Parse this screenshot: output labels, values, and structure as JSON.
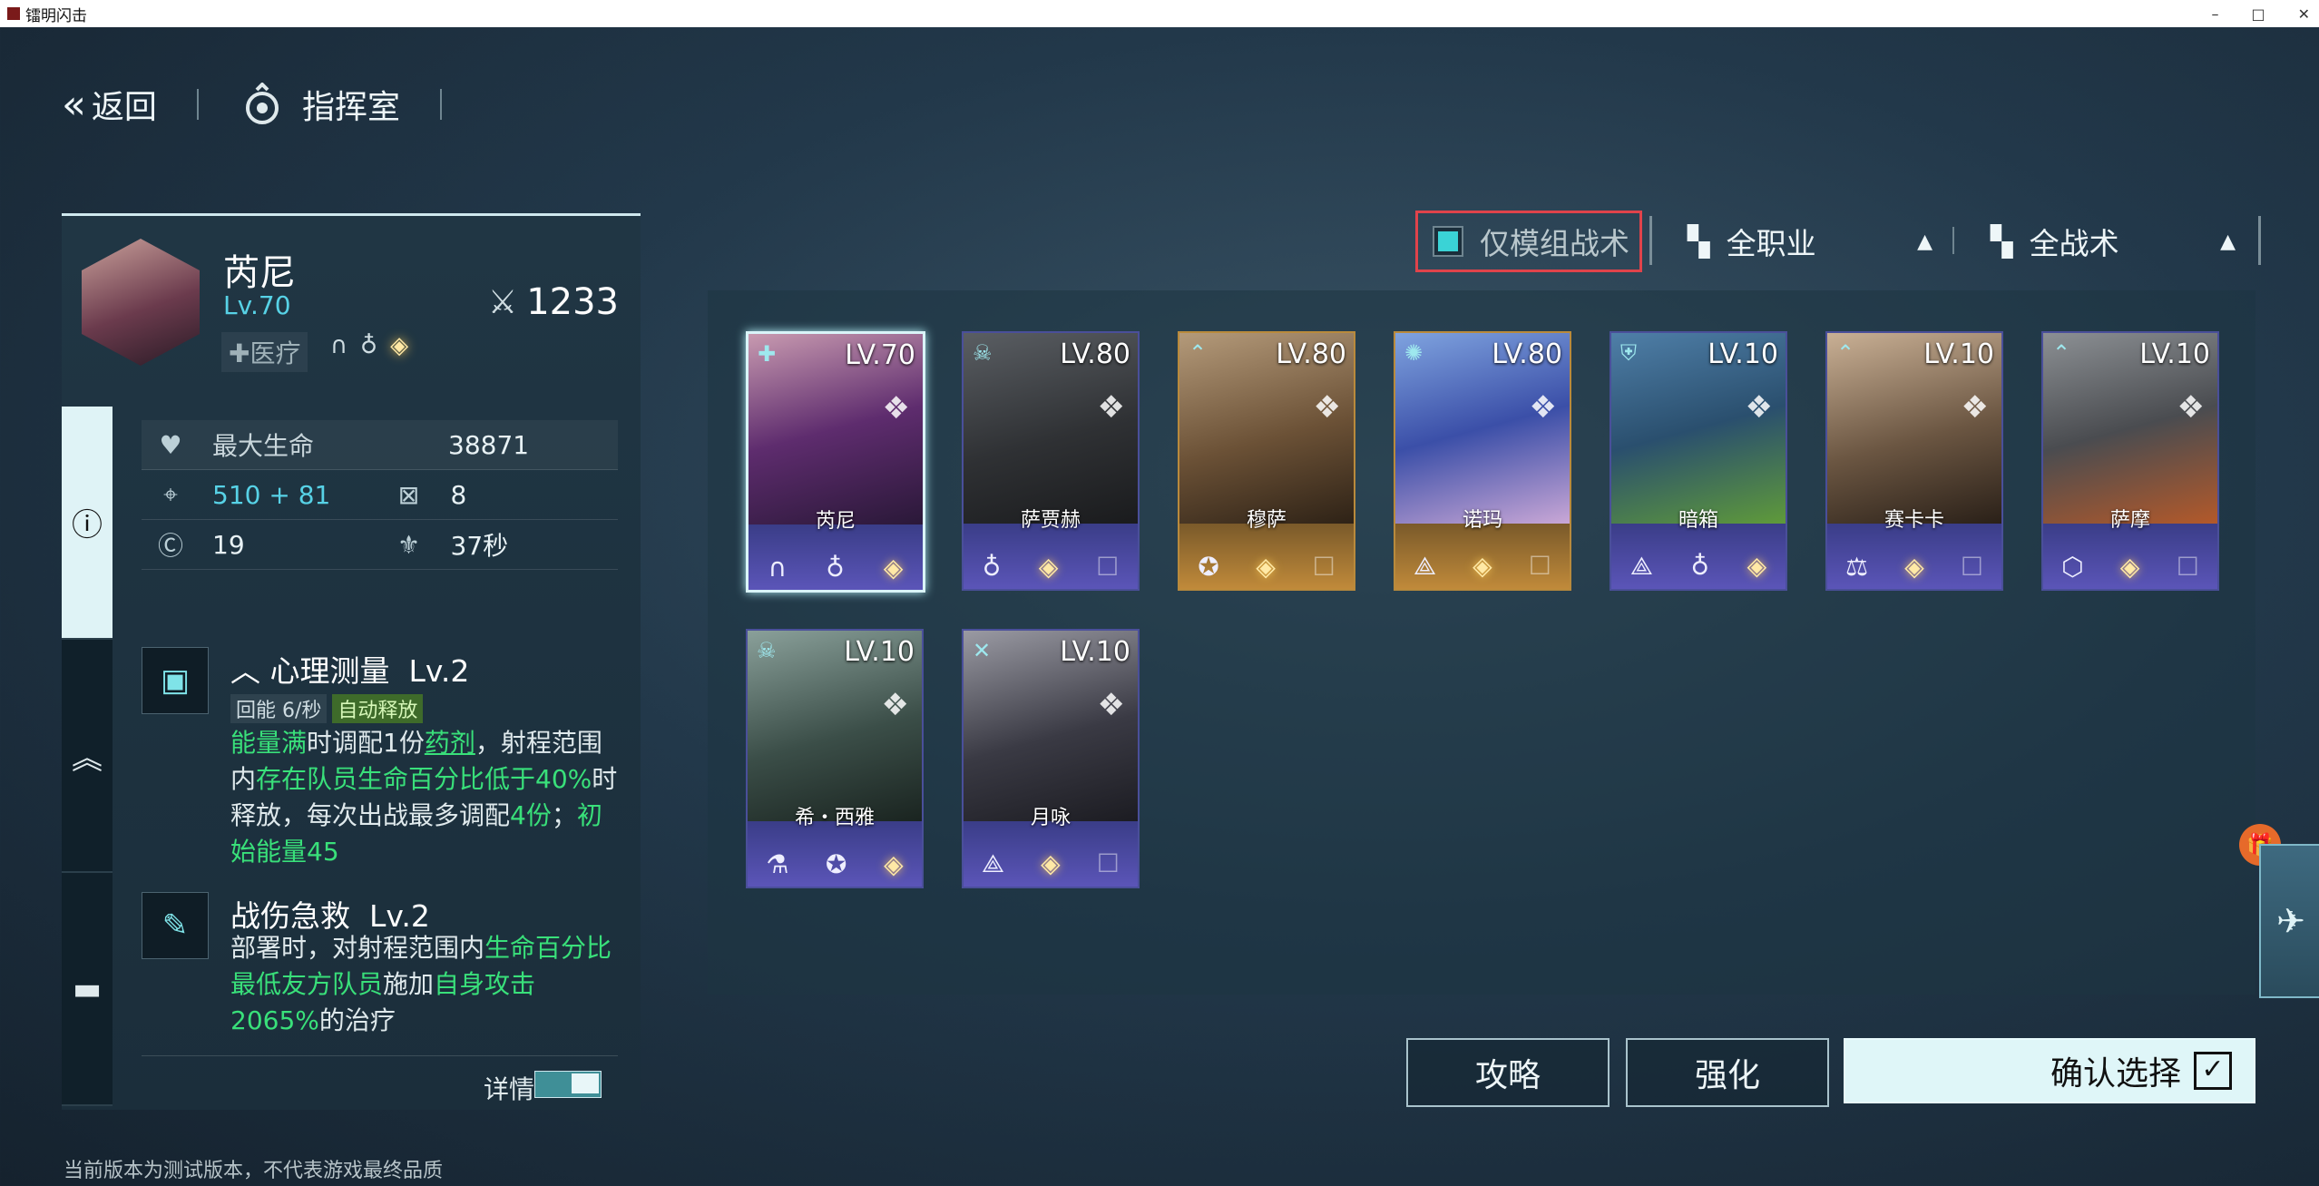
{
  "window": {
    "title": "镭明闪击",
    "controls": [
      "–",
      "□",
      "✕"
    ]
  },
  "nav": {
    "back_label": "返回",
    "room_label": "指挥室"
  },
  "character": {
    "name": "芮尼",
    "level": "Lv.70",
    "power": "1233",
    "role": "医疗",
    "stats": {
      "hp_label": "最大生命",
      "hp_value": "38871",
      "atk_base": "510",
      "atk_bonus": "+ 81",
      "range_value": "8",
      "cost_value": "19",
      "redeploy_value": "37秒"
    }
  },
  "skills": [
    {
      "name": "心理测量",
      "level": "Lv.2",
      "regen": "回能 6/秒",
      "trigger": "自动释放",
      "desc": {
        "p1": "能量满",
        "p2": "时调配1份",
        "p3": "药剂",
        "p4": "，射程范围内",
        "p5": "存在队员生命百分比低于40%",
        "p6": "时释放，每次出战最多调配",
        "p7": "4份",
        "p8": "；",
        "p9": "初始能量45"
      }
    },
    {
      "name": "战伤急救",
      "level": "Lv.2",
      "desc": {
        "p1": "部署时，对射程范围内",
        "p2": "生命百分比最低友方队员",
        "p3": "施加",
        "p4": "自身攻击2065%",
        "p5": "的治疗"
      }
    }
  ],
  "detail_label": "详情",
  "filters": {
    "module_only": "仅模组战术",
    "all_class": "全职业",
    "all_tactics": "全战术"
  },
  "roster": [
    {
      "name": "芮尼",
      "level": "LV.70",
      "selected": true,
      "rarity": "purple"
    },
    {
      "name": "萨贾赫",
      "level": "LV.80",
      "rarity": "purple"
    },
    {
      "name": "穆萨",
      "level": "LV.80",
      "rarity": "gold"
    },
    {
      "name": "诺玛",
      "level": "LV.80",
      "rarity": "gold"
    },
    {
      "name": "暗箱",
      "level": "LV.10",
      "rarity": "purple"
    },
    {
      "name": "赛卡卡",
      "level": "LV.10",
      "rarity": "purple"
    },
    {
      "name": "萨摩",
      "level": "LV.10",
      "rarity": "purple"
    },
    {
      "name": "希・西雅",
      "level": "LV.10",
      "rarity": "purple"
    },
    {
      "name": "月咏",
      "level": "LV.10",
      "rarity": "purple"
    }
  ],
  "buttons": {
    "guide": "攻略",
    "enhance": "强化",
    "confirm": "确认选择"
  },
  "footer": "当前版本为测试版本，不代表游戏最终品质",
  "colors": {
    "accent": "#57d2e6",
    "highlight": "#39e07a",
    "filter_border": "#e0434b",
    "purple": "#5b55b8",
    "gold": "#c08a3a"
  }
}
